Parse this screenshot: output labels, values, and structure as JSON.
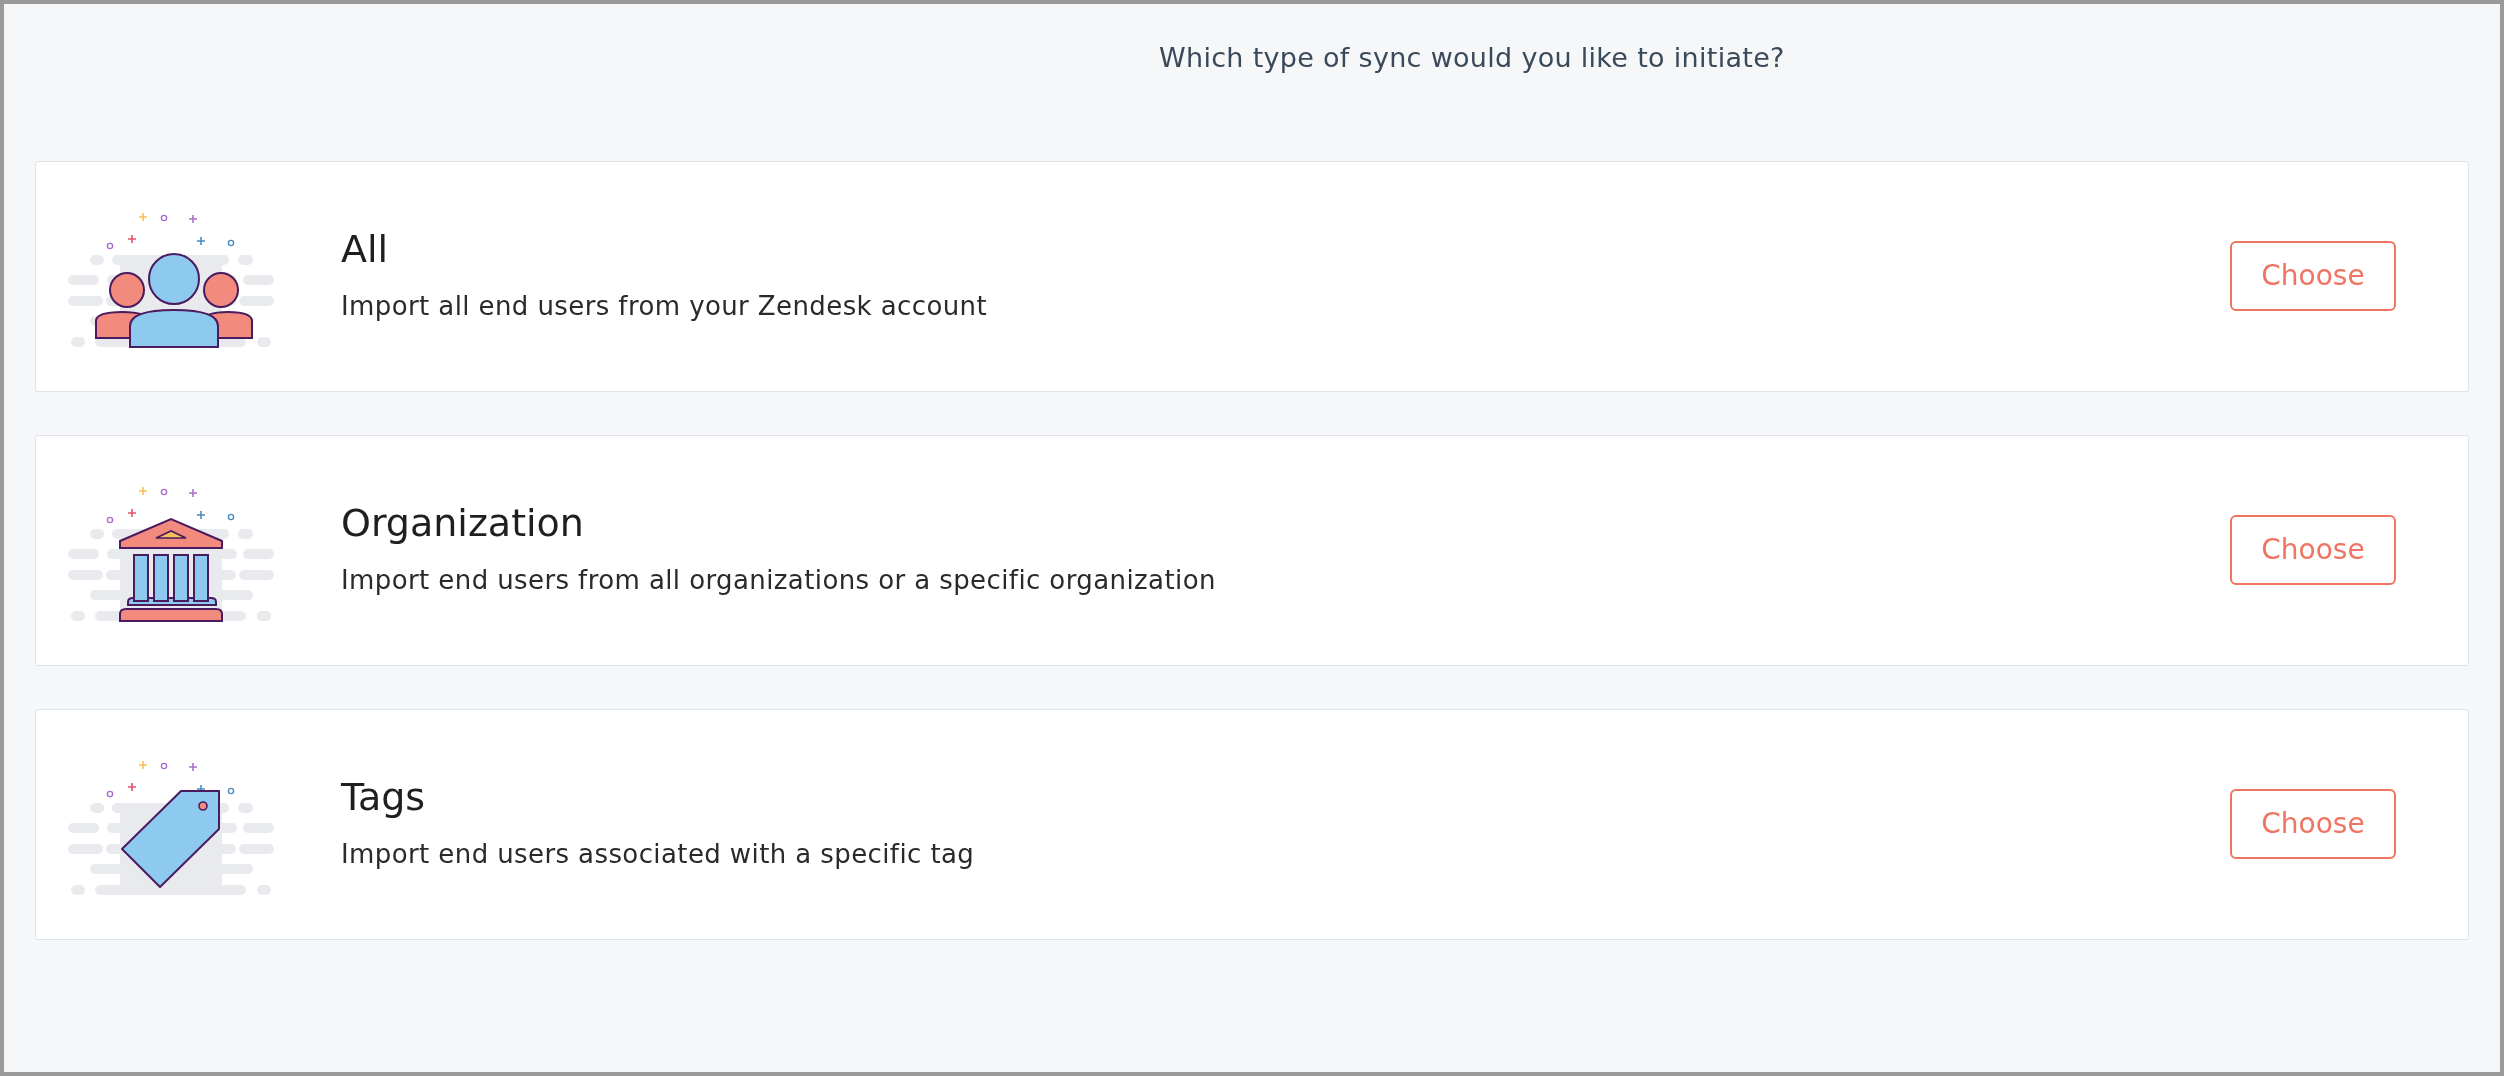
{
  "heading": "Which type of sync would you like to initiate?",
  "options": [
    {
      "kind": "people",
      "title": "All",
      "description": "Import all end users from your Zendesk account",
      "button": "Choose"
    },
    {
      "kind": "building",
      "title": "Organization",
      "description": "Import end users from all organizations or a specific organization",
      "button": "Choose"
    },
    {
      "kind": "tag",
      "title": "Tags",
      "description": "Import end users associated with a specific tag",
      "button": "Choose"
    }
  ]
}
